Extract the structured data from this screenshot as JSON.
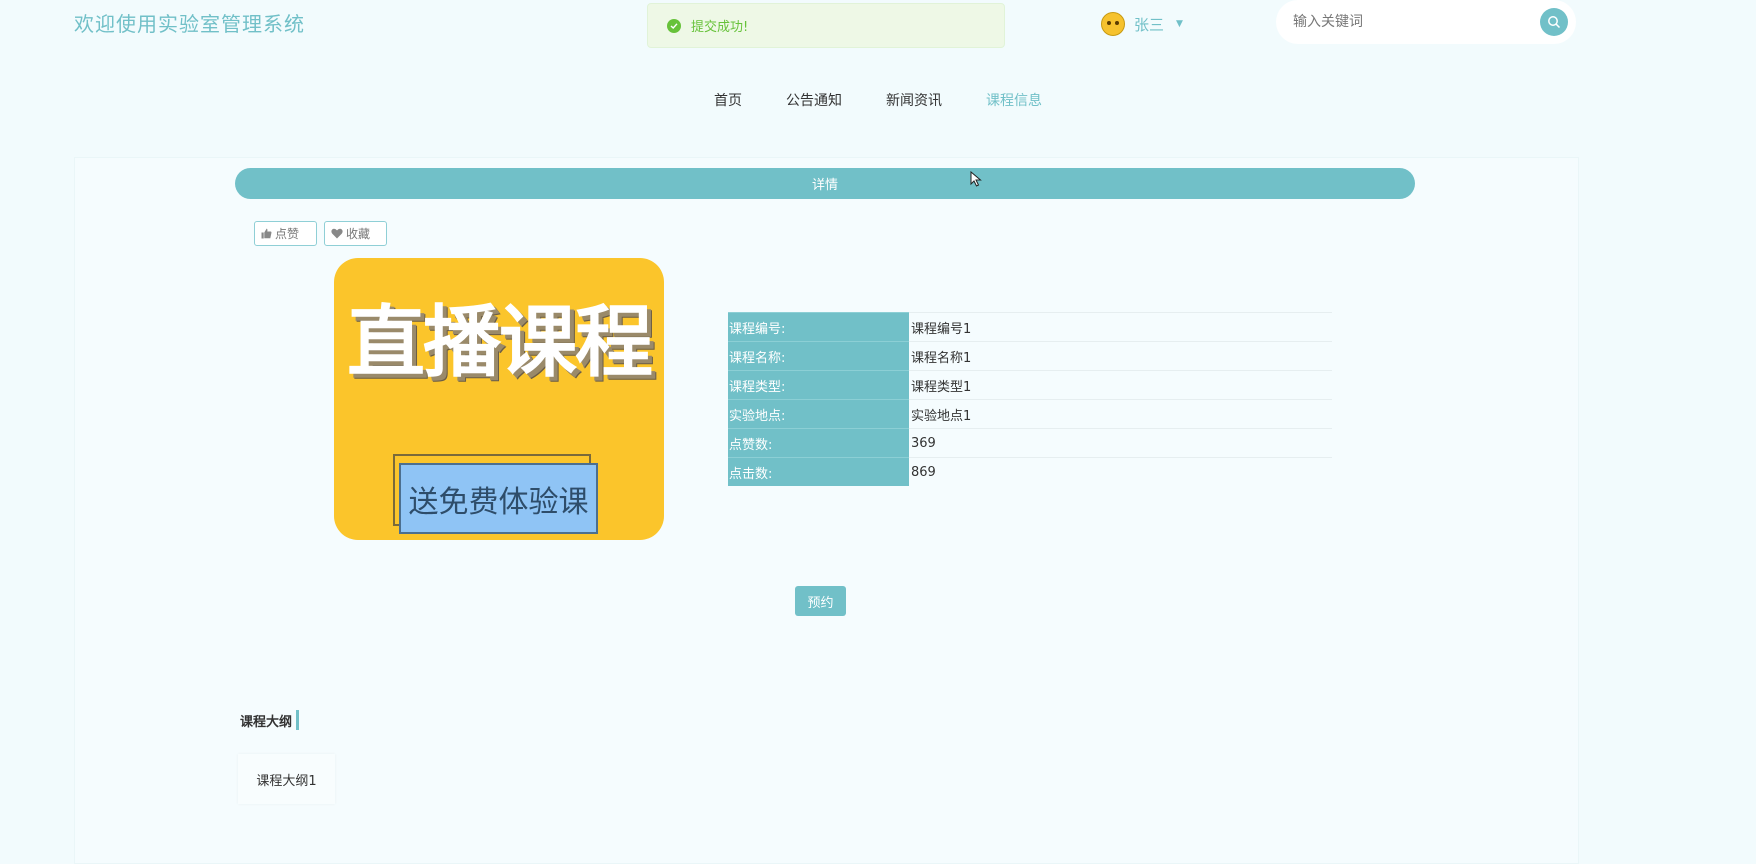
{
  "header": {
    "site_title": "欢迎使用实验室管理系统",
    "toast_message": "提交成功!",
    "user_name": "张三",
    "search_placeholder": "输入关键词"
  },
  "nav": {
    "items": [
      {
        "label": "首页"
      },
      {
        "label": "公告通知"
      },
      {
        "label": "新闻资讯"
      },
      {
        "label": "课程信息",
        "active": true
      }
    ]
  },
  "detail": {
    "bar_title": "详情",
    "like_label": "点赞",
    "favorite_label": "收藏",
    "image": {
      "title": "直播课程",
      "subtitle": "送免费体验课"
    },
    "fields": [
      {
        "label": "课程编号:",
        "value": "课程编号1"
      },
      {
        "label": "课程名称:",
        "value": "课程名称1"
      },
      {
        "label": "课程类型:",
        "value": "课程类型1"
      },
      {
        "label": "实验地点:",
        "value": "实验地点1"
      },
      {
        "label": "点赞数:",
        "value": "369"
      },
      {
        "label": "点击数:",
        "value": "869"
      }
    ],
    "reserve_label": "预约",
    "outline_heading": "课程大纲",
    "outline_text": "课程大纲1"
  },
  "colors": {
    "accent": "#71c0c8",
    "success": "#67c23a",
    "background": "#f2fbfd",
    "image_yellow": "#fbc52b",
    "image_blue": "#8fc4f5"
  }
}
